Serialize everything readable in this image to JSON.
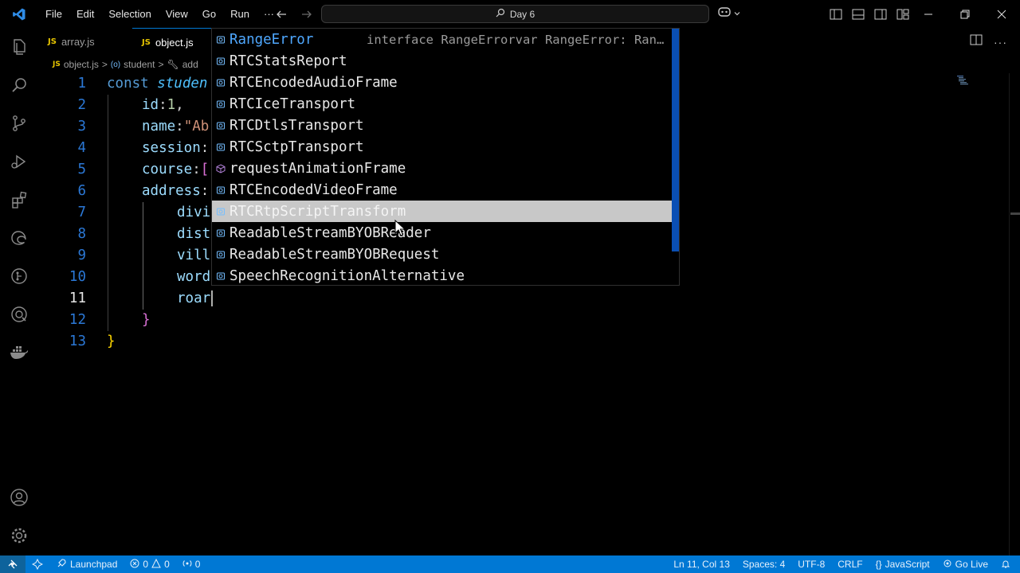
{
  "titlebar": {
    "menu": [
      "File",
      "Edit",
      "Selection",
      "View",
      "Go",
      "Run",
      "···"
    ],
    "search_text": "Day 6"
  },
  "tabs": [
    {
      "label": "array.js",
      "badge": "JS",
      "active": false
    },
    {
      "label": "object.js",
      "badge": "JS",
      "active": true
    }
  ],
  "breadcrumb": {
    "badge": "JS",
    "file": "object.js",
    "sep": ">",
    "symbol1": "student",
    "symbol2": "add"
  },
  "editor": {
    "current_line": 11,
    "lines": [
      {
        "n": "1"
      },
      {
        "n": "2"
      },
      {
        "n": "3"
      },
      {
        "n": "4"
      },
      {
        "n": "5"
      },
      {
        "n": "6"
      },
      {
        "n": "7"
      },
      {
        "n": "8"
      },
      {
        "n": "9"
      },
      {
        "n": "10"
      },
      {
        "n": "11"
      },
      {
        "n": "12"
      },
      {
        "n": "13"
      }
    ],
    "code": {
      "l1_kw": "const",
      "l1_var": "studen",
      "l2_prop": "id",
      "l2_colon": ":",
      "l2_num": "1",
      "l2_comma": ",",
      "l3_prop": "name",
      "l3_colon": ":",
      "l3_str": "\"Ab",
      "l4_prop": "session",
      "l4_colon": ":",
      "l5_prop": "course",
      "l5_colon": ":",
      "l5_br": "[",
      "l6_prop": "address",
      "l6_colon": ":",
      "l7_prop": "divi",
      "l8_prop": "dist",
      "l9_prop": "vill",
      "l10_prop": "word",
      "l11_prop": "roar",
      "l12_br": "}",
      "l13_br": "}"
    }
  },
  "suggest": {
    "items": [
      {
        "label": "RangeError",
        "detail": "interface RangeErrorvar RangeError: Ran…",
        "kind": "class"
      },
      {
        "label": "RTCStatsReport",
        "kind": "class"
      },
      {
        "label": "RTCEncodedAudioFrame",
        "kind": "class"
      },
      {
        "label": "RTCIceTransport",
        "kind": "class"
      },
      {
        "label": "RTCDtlsTransport",
        "kind": "class"
      },
      {
        "label": "RTCSctpTransport",
        "kind": "class"
      },
      {
        "label": "requestAnimationFrame",
        "kind": "method"
      },
      {
        "label": "RTCEncodedVideoFrame",
        "kind": "class"
      },
      {
        "label": "RTCRtpScriptTransform",
        "kind": "class"
      },
      {
        "label": "ReadableStreamBYOBReader",
        "kind": "class"
      },
      {
        "label": "ReadableStreamBYOBRequest",
        "kind": "class"
      },
      {
        "label": "SpeechRecognitionAlternative",
        "kind": "class"
      }
    ],
    "selected_index": 8
  },
  "statusbar": {
    "launchpad": "Launchpad",
    "errors": "0",
    "warnings": "0",
    "ports": "0",
    "position": "Ln 11, Col 13",
    "spaces": "Spaces: 4",
    "encoding": "UTF-8",
    "eol": "CRLF",
    "language": "JavaScript",
    "golive": "Go Live"
  },
  "colors": {
    "accent": "#0078d4",
    "line_number": "#2b78d6",
    "suggest_selected_bg": "#c8c8c8",
    "js_badge": "#e8c600"
  }
}
